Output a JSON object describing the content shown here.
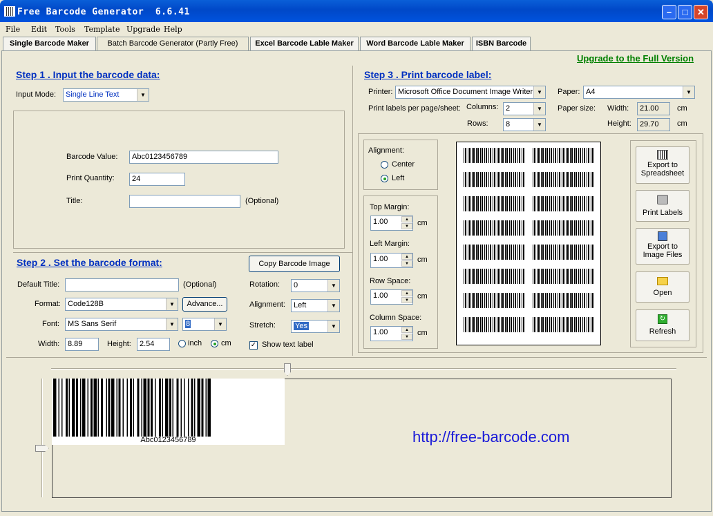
{
  "window": {
    "title": "Free Barcode Generator  6.6.41"
  },
  "menu": [
    "File",
    "Edit",
    "Tools",
    "Template",
    "Upgrade",
    "Help"
  ],
  "tabs": [
    "Single Barcode Maker",
    "Batch Barcode Generator (Partly Free)",
    "Excel Barcode Lable Maker",
    "Word Barcode Lable Maker",
    "ISBN Barcode"
  ],
  "upgrade_link": "Upgrade to the Full Version",
  "step1": {
    "title": "Step 1 .  Input the barcode data:",
    "input_mode_label": "Input Mode:",
    "input_mode_value": "Single Line Text",
    "barcode_value_label": "Barcode Value:",
    "barcode_value": "Abc0123456789",
    "print_qty_label": "Print Quantity:",
    "print_qty": "24",
    "title_label": "Title:",
    "title_value": "",
    "optional": "(Optional)"
  },
  "step2": {
    "title": "Step 2 . Set the barcode format:",
    "copy_button": "Copy Barcode Image",
    "default_title_label": "Default Title:",
    "default_title_value": "",
    "optional": "(Optional)",
    "format_label": "Format:",
    "format_value": "Code128B",
    "advance_button": "Advance...",
    "font_label": "Font:",
    "font_value": "MS Sans Serif",
    "font_size": "8",
    "width_label": "Width:",
    "width_value": "8.89",
    "height_label": "Height:",
    "height_value": "2.54",
    "unit_inch": "inch",
    "unit_cm": "cm",
    "rotation_label": "Rotation:",
    "rotation_value": "0",
    "alignment_label": "Alignment:",
    "alignment_value": "Left",
    "stretch_label": "Stretch:",
    "stretch_value": "Yes",
    "show_text_label": "Show text label"
  },
  "step3": {
    "title": "Step 3 . Print barcode label:",
    "printer_label": "Printer:",
    "printer_value": "Microsoft Office Document Image Writer",
    "paper_label": "Paper:",
    "paper_value": "A4",
    "per_page_label": "Print labels per page/sheet:",
    "columns_label": "Columns:",
    "columns_value": "2",
    "rows_label": "Rows:",
    "rows_value": "8",
    "paper_size_label": "Paper size:",
    "width_label": "Width:",
    "width_value": "21.00",
    "height_label": "Height:",
    "height_value": "29.70",
    "unit": "cm",
    "alignment_label": "Alignment:",
    "center_label": "Center",
    "left_label": "Left",
    "top_margin_label": "Top Margin:",
    "top_margin": "1.00",
    "left_margin_label": "Left Margin:",
    "left_margin": "1.00",
    "row_space_label": "Row Space:",
    "row_space": "1.00",
    "column_space_label": "Column Space:",
    "column_space": "1.00",
    "buttons": {
      "export_spreadsheet": [
        "Export to",
        "Spreadsheet"
      ],
      "print_labels": "Print Labels",
      "export_image": [
        "Export to",
        "Image Files"
      ],
      "open": "Open",
      "refresh": "Refresh"
    }
  },
  "preview": {
    "barcode_text": "Abc0123456789",
    "url": "http://free-barcode.com"
  }
}
